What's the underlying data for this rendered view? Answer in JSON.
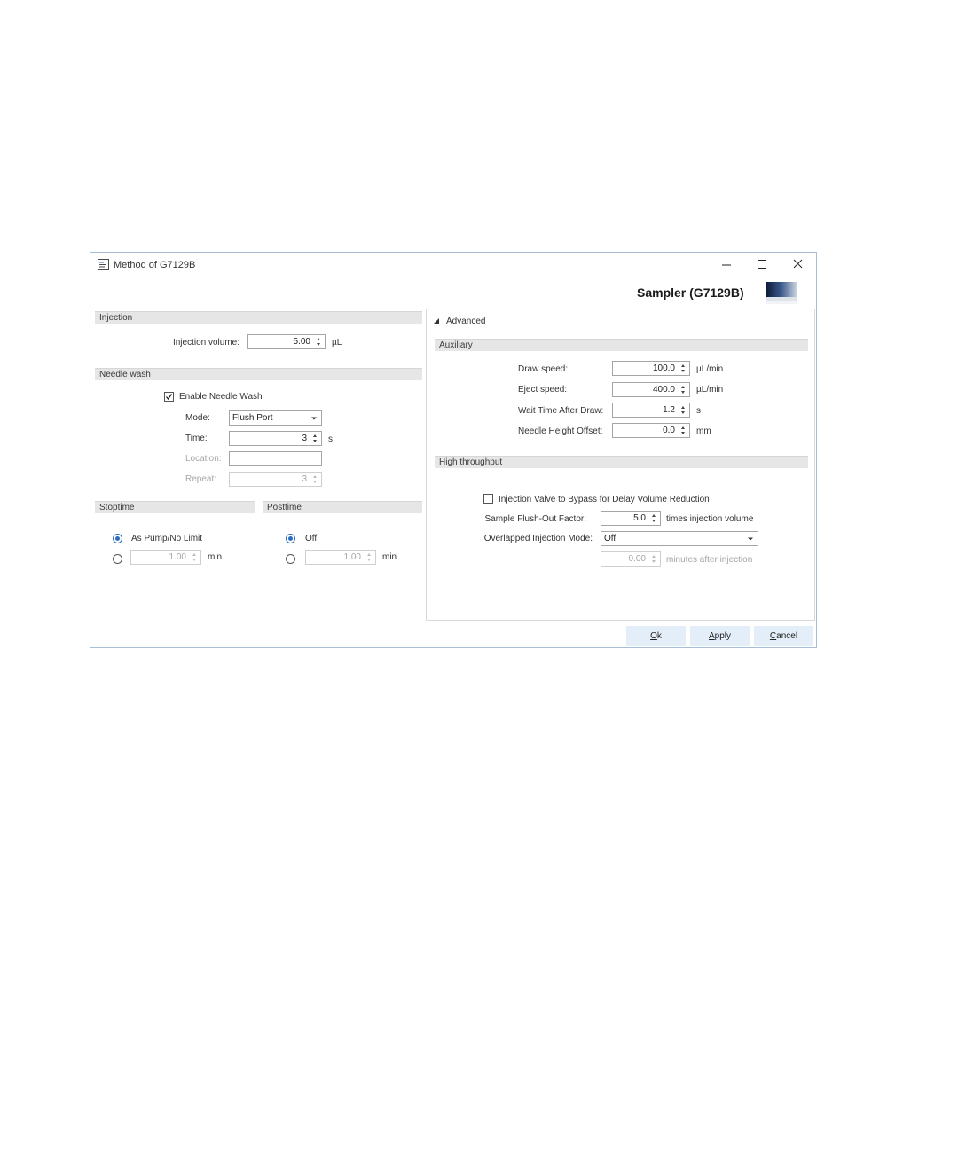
{
  "window": {
    "title": "Method of G7129B",
    "module_name": "Sampler (G7129B)",
    "buttons": {
      "minimize_icon": "minimize-icon",
      "maximize_icon": "maximize-icon",
      "close_icon": "close-icon"
    }
  },
  "injection": {
    "header": "Injection",
    "volume_label": "Injection volume:",
    "volume_value": "5.00",
    "volume_unit": "µL"
  },
  "needle_wash": {
    "header": "Needle wash",
    "enable_label": "Enable Needle Wash",
    "enabled": true,
    "mode_label": "Mode:",
    "mode_value": "Flush Port",
    "time_label": "Time:",
    "time_value": "3",
    "time_unit": "s",
    "location_label": "Location:",
    "location_value": "",
    "repeat_label": "Repeat:",
    "repeat_value": "3"
  },
  "stoptime": {
    "header": "Stoptime",
    "option_1": "As Pump/No Limit",
    "option_2_value": "1.00",
    "unit": "min",
    "selected": 1
  },
  "posttime": {
    "header": "Posttime",
    "option_1": "Off",
    "option_2_value": "1.00",
    "unit": "min",
    "selected": 1
  },
  "advanced": {
    "header": "Advanced",
    "auxiliary": {
      "header": "Auxiliary",
      "draw_speed_label": "Draw speed:",
      "draw_speed_value": "100.0",
      "draw_speed_unit": "µL/min",
      "eject_speed_label": "Eject speed:",
      "eject_speed_value": "400.0",
      "eject_speed_unit": "µL/min",
      "wait_time_label": "Wait Time After Draw:",
      "wait_time_value": "1.2",
      "wait_time_unit": "s",
      "needle_offset_label": "Needle Height Offset:",
      "needle_offset_value": "0.0",
      "needle_offset_unit": "mm"
    },
    "high_throughput": {
      "header": "High throughput",
      "bypass_label": "Injection Valve to Bypass for Delay Volume Reduction",
      "bypass_checked": false,
      "flush_label": "Sample Flush-Out Factor:",
      "flush_value": "5.0",
      "flush_unit": "times injection volume",
      "overlap_label": "Overlapped Injection Mode:",
      "overlap_value": "Off",
      "overlap_minutes_value": "0.00",
      "overlap_minutes_unit": "minutes after injection"
    }
  },
  "footer": {
    "ok_mnemonic": "O",
    "ok_rest": "k",
    "apply_mnemonic": "A",
    "apply_rest": "pply",
    "cancel_mnemonic": "C",
    "cancel_rest": "ancel"
  }
}
